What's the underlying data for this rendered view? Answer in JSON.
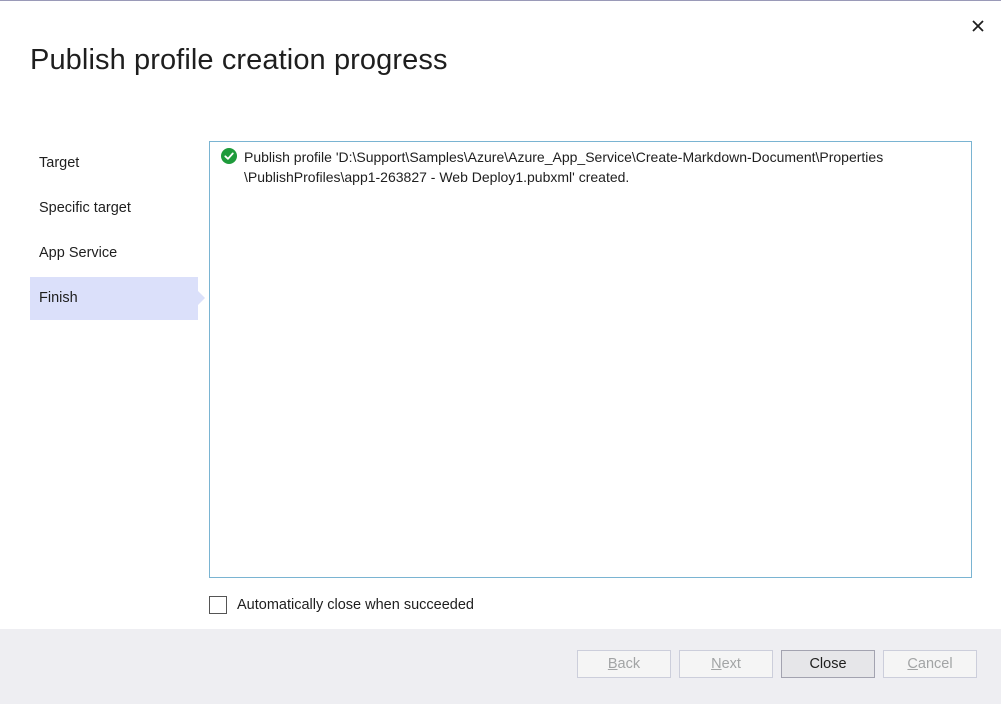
{
  "dialog": {
    "title": "Publish profile creation progress",
    "close_icon": "close-icon"
  },
  "steps": [
    {
      "label": "Target",
      "selected": false
    },
    {
      "label": "Specific target",
      "selected": false
    },
    {
      "label": "App Service",
      "selected": false
    },
    {
      "label": "Finish",
      "selected": true
    }
  ],
  "log": {
    "entries": [
      {
        "status_icon": "success-check-icon",
        "line1": "Publish profile 'D:\\Support\\Samples\\Azure\\Azure_App_Service\\Create-Markdown-Document\\Properties",
        "line2": "\\PublishProfiles\\app1-263827 - Web Deploy1.pubxml' created."
      }
    ]
  },
  "auto_close": {
    "label": "Automatically close when succeeded",
    "checked": false
  },
  "footer": {
    "back": {
      "mnemonic": "B",
      "rest": "ack",
      "enabled": false
    },
    "next": {
      "mnemonic": "N",
      "rest": "ext",
      "enabled": false
    },
    "close": {
      "label": "Close",
      "enabled": true
    },
    "cancel": {
      "mnemonic": "C",
      "rest": "ancel",
      "enabled": false
    }
  },
  "colors": {
    "selected_step": "#dbe0fa",
    "log_border": "#7ab4d2",
    "success": "#1e9b3b",
    "footer_bg": "#eeeef2"
  }
}
